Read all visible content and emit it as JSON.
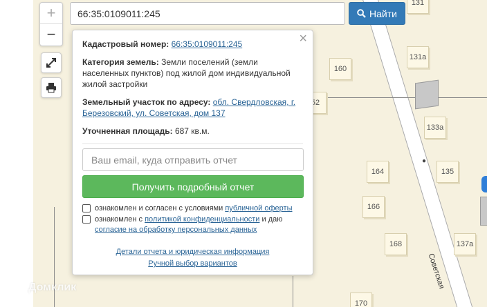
{
  "zoom": {
    "in_label": "+",
    "out_label": "−"
  },
  "search": {
    "value": "66:35:0109011:245",
    "button_label": "Найти"
  },
  "popup": {
    "close_label": "×",
    "cadastral": {
      "label": "Кадастровый номер:",
      "value": "66:35:0109011:245"
    },
    "category": {
      "label": "Категория земель:",
      "value": "Земли поселений (земли населенных пунктов) под жилой дом индивидуальной жилой застройки"
    },
    "address": {
      "label": "Земельный участок по адресу:",
      "value": "обл. Свердловская, г. Березовский, ул. Советская, дом 137"
    },
    "area": {
      "label": "Уточненная площадь:",
      "value": "687 кв.м."
    },
    "email_placeholder": "Ваш email, куда отправить отчет",
    "submit_label": "Получить подробный отчет",
    "consent1": {
      "text": "ознакомлен и согласен с условиями ",
      "link": "публичной оферты"
    },
    "consent2": {
      "text": "ознакомлен с ",
      "link1": "политикой конфиденциальности",
      "mid": " и даю",
      "link2": "согласие на обработку персональных данных"
    },
    "footer_link1": "Детали отчета и юридическая информация",
    "footer_link2": "Ручной выбор вариантов"
  },
  "map": {
    "houses": [
      "131",
      "131а",
      "160",
      "133а",
      "52",
      "164",
      "135",
      "166",
      "168",
      "137а",
      "170"
    ],
    "street": "Советская"
  },
  "logo": "Домклик",
  "colors": {
    "accent": "#337ab7",
    "success": "#5cb85c",
    "map_bg": "#f6f1df"
  }
}
